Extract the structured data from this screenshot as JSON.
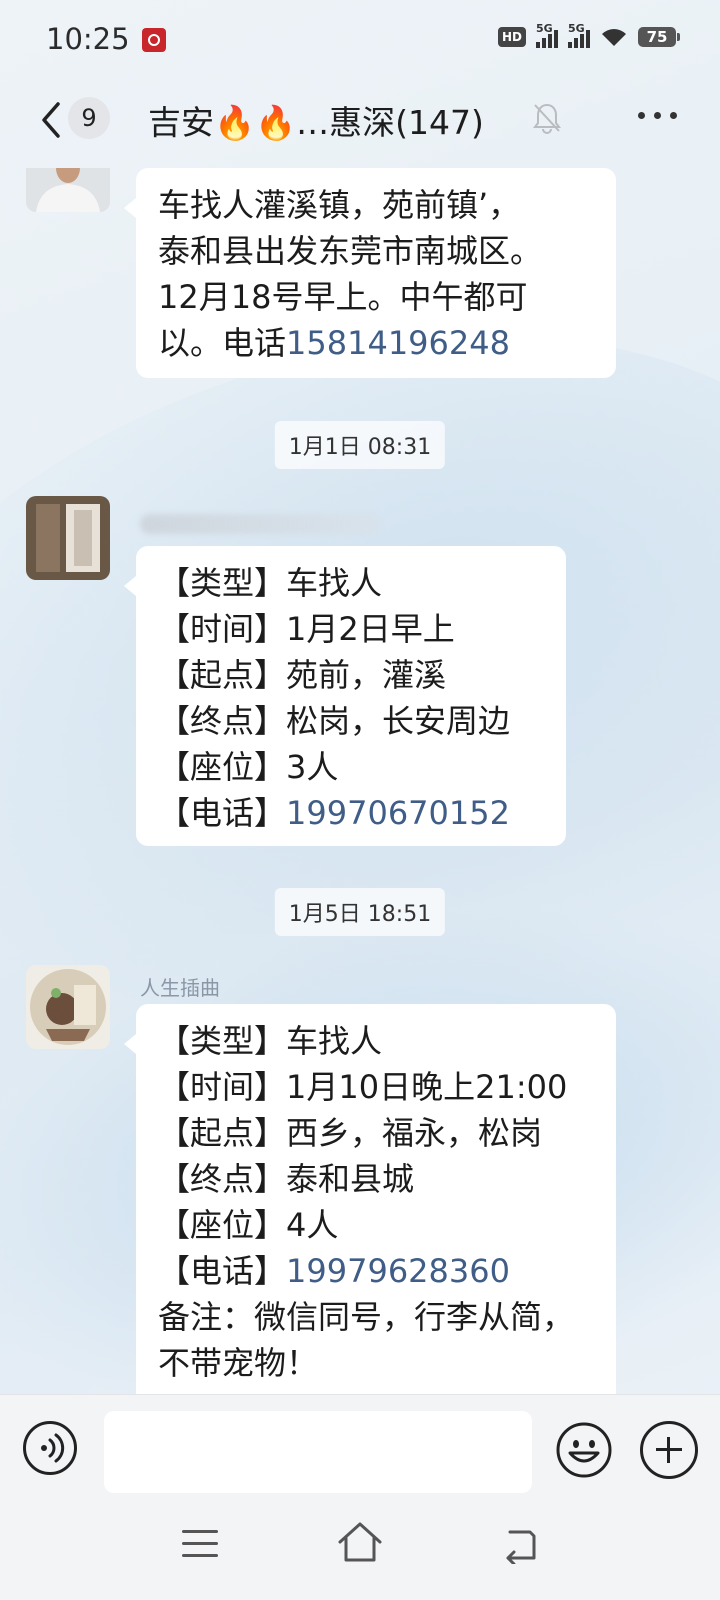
{
  "status_bar": {
    "time": "10:25",
    "battery": "75",
    "network_1": "5G",
    "network_2": "5G",
    "hd": "HD"
  },
  "header": {
    "unread_count": "9",
    "title": "吉安🔥🔥…惠深(147)"
  },
  "messages": [
    {
      "lines": [
        "车找人灌溪镇，苑前镇’，",
        "泰和县出发东莞市南城区。",
        "12月18号早上。中午都可",
        "以。电话"
      ],
      "phone": "15814196248"
    }
  ],
  "timestamps": [
    "1月1日 08:31",
    "1月5日 18:51"
  ],
  "message2": {
    "type_label": "【类型】",
    "type_value": "车找人",
    "time_label": "【时间】",
    "time_value": "1月2日早上",
    "start_label": "【起点】",
    "start_value": "苑前，灌溪",
    "end_label": "【终点】",
    "end_value": "松岗，长安周边",
    "seat_label": "【座位】",
    "seat_value": "3人",
    "phone_label": "【电话】",
    "phone_value": "19970670152"
  },
  "message3": {
    "sender": "人生插曲",
    "type_label": "【类型】",
    "type_value": "车找人",
    "time_label": "【时间】",
    "time_value": "1月10日晚上21:00",
    "start_label": "【起点】",
    "start_value": "西乡，福永，松岗",
    "end_label": "【终点】",
    "end_value": "泰和县城",
    "seat_label": "【座位】",
    "seat_value": "4人",
    "phone_label": "【电话】",
    "phone_value": "19979628360",
    "note": "备注：微信同号，行李从简，",
    "note_cut": "不带宠物！"
  },
  "icons": {
    "back": "chevron-left-icon",
    "mute": "bell-off-icon",
    "more": "more-icon",
    "voice": "voice-icon",
    "emoji": "emoji-icon",
    "plus": "plus-icon"
  },
  "colors": {
    "phone_link": "#3f5d86",
    "bubble": "#ffffff"
  }
}
